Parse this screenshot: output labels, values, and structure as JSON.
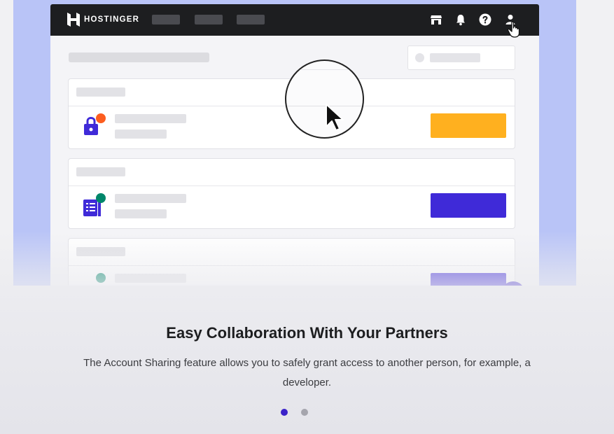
{
  "app": {
    "brand": "HOSTINGER",
    "colors": {
      "topbar": "#1d1e20",
      "accent_purple": "#3f2ad8",
      "accent_orange": "#ffb01f",
      "badge_orange": "#fc5d1f",
      "badge_green": "#00866a",
      "stage_blue": "#b9c4f7"
    },
    "topbar_icons": [
      "store-icon",
      "bell-icon",
      "help-icon",
      "user-icon"
    ],
    "cards": [
      {
        "icon": "lock-icon",
        "badge": "orange",
        "button_color": "#ffb01f"
      },
      {
        "icon": "document-list-icon",
        "badge": "green",
        "button_color": "#3f2ad8"
      },
      {
        "icon": "generic-icon",
        "badge": "green",
        "button_color": "#3f2ad8"
      }
    ]
  },
  "slide": {
    "title": "Easy Collaboration With Your Partners",
    "description": "The Account Sharing feature allows you to safely grant access to another person, for example, a developer."
  },
  "pagination": {
    "total": 2,
    "active_index": 0,
    "active_color": "#3a22c9",
    "inactive_color": "#a5a5ad"
  }
}
